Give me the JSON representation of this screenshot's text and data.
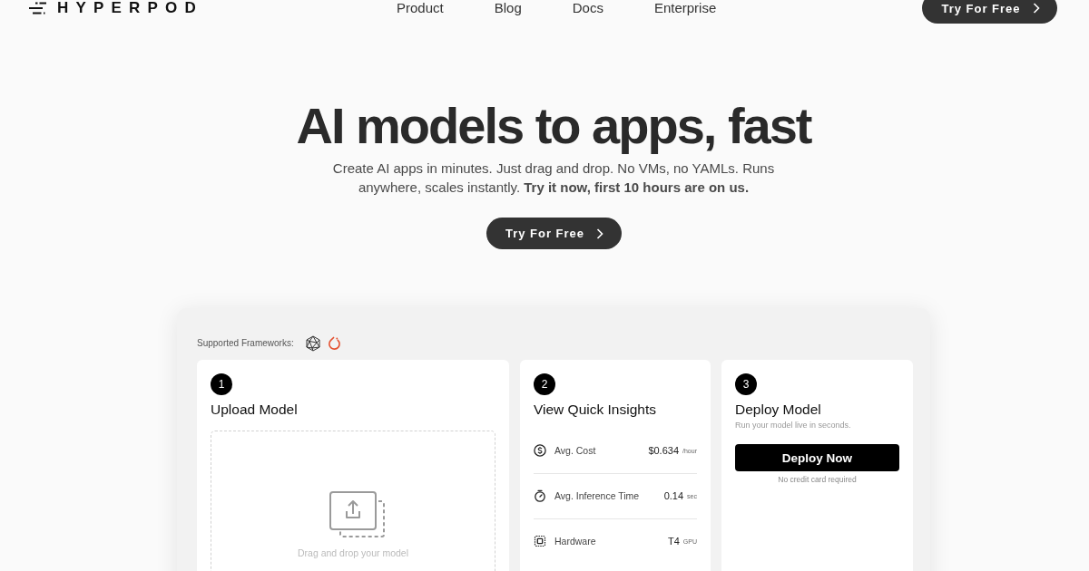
{
  "header": {
    "logo": "HYPERPOD",
    "nav": [
      "Product",
      "Blog",
      "Docs",
      "Enterprise"
    ],
    "cta": "Try For Free"
  },
  "hero": {
    "title": "AI models to apps, fast",
    "subtitle": "Create AI apps in minutes. Just drag and drop. No VMs, no YAMLs. Runs anywhere, scales instantly. **Try it now, first 10 hours are on us.**",
    "cta": "Try For Free"
  },
  "panel": {
    "frameworks_label": "Supported Frameworks:",
    "steps": [
      {
        "kind": "upload",
        "number": "1",
        "title": "Upload Model",
        "dropzone_text": "Drag and drop your model"
      },
      {
        "kind": "insights",
        "number": "2",
        "title": "View Quick Insights",
        "metrics": [
          {
            "label": "Avg. Cost",
            "value": "$0.634",
            "unit": "/hour"
          },
          {
            "label": "Avg. Inference Time",
            "value": "0.14",
            "unit": "sec"
          },
          {
            "label": "Hardware",
            "value": "T4",
            "unit": "GPU"
          }
        ]
      },
      {
        "kind": "deploy",
        "number": "3",
        "title": "Deploy Model",
        "subtitle": "Run your model live in seconds.",
        "button": "Deploy Now",
        "note": "No credit card required"
      }
    ]
  }
}
